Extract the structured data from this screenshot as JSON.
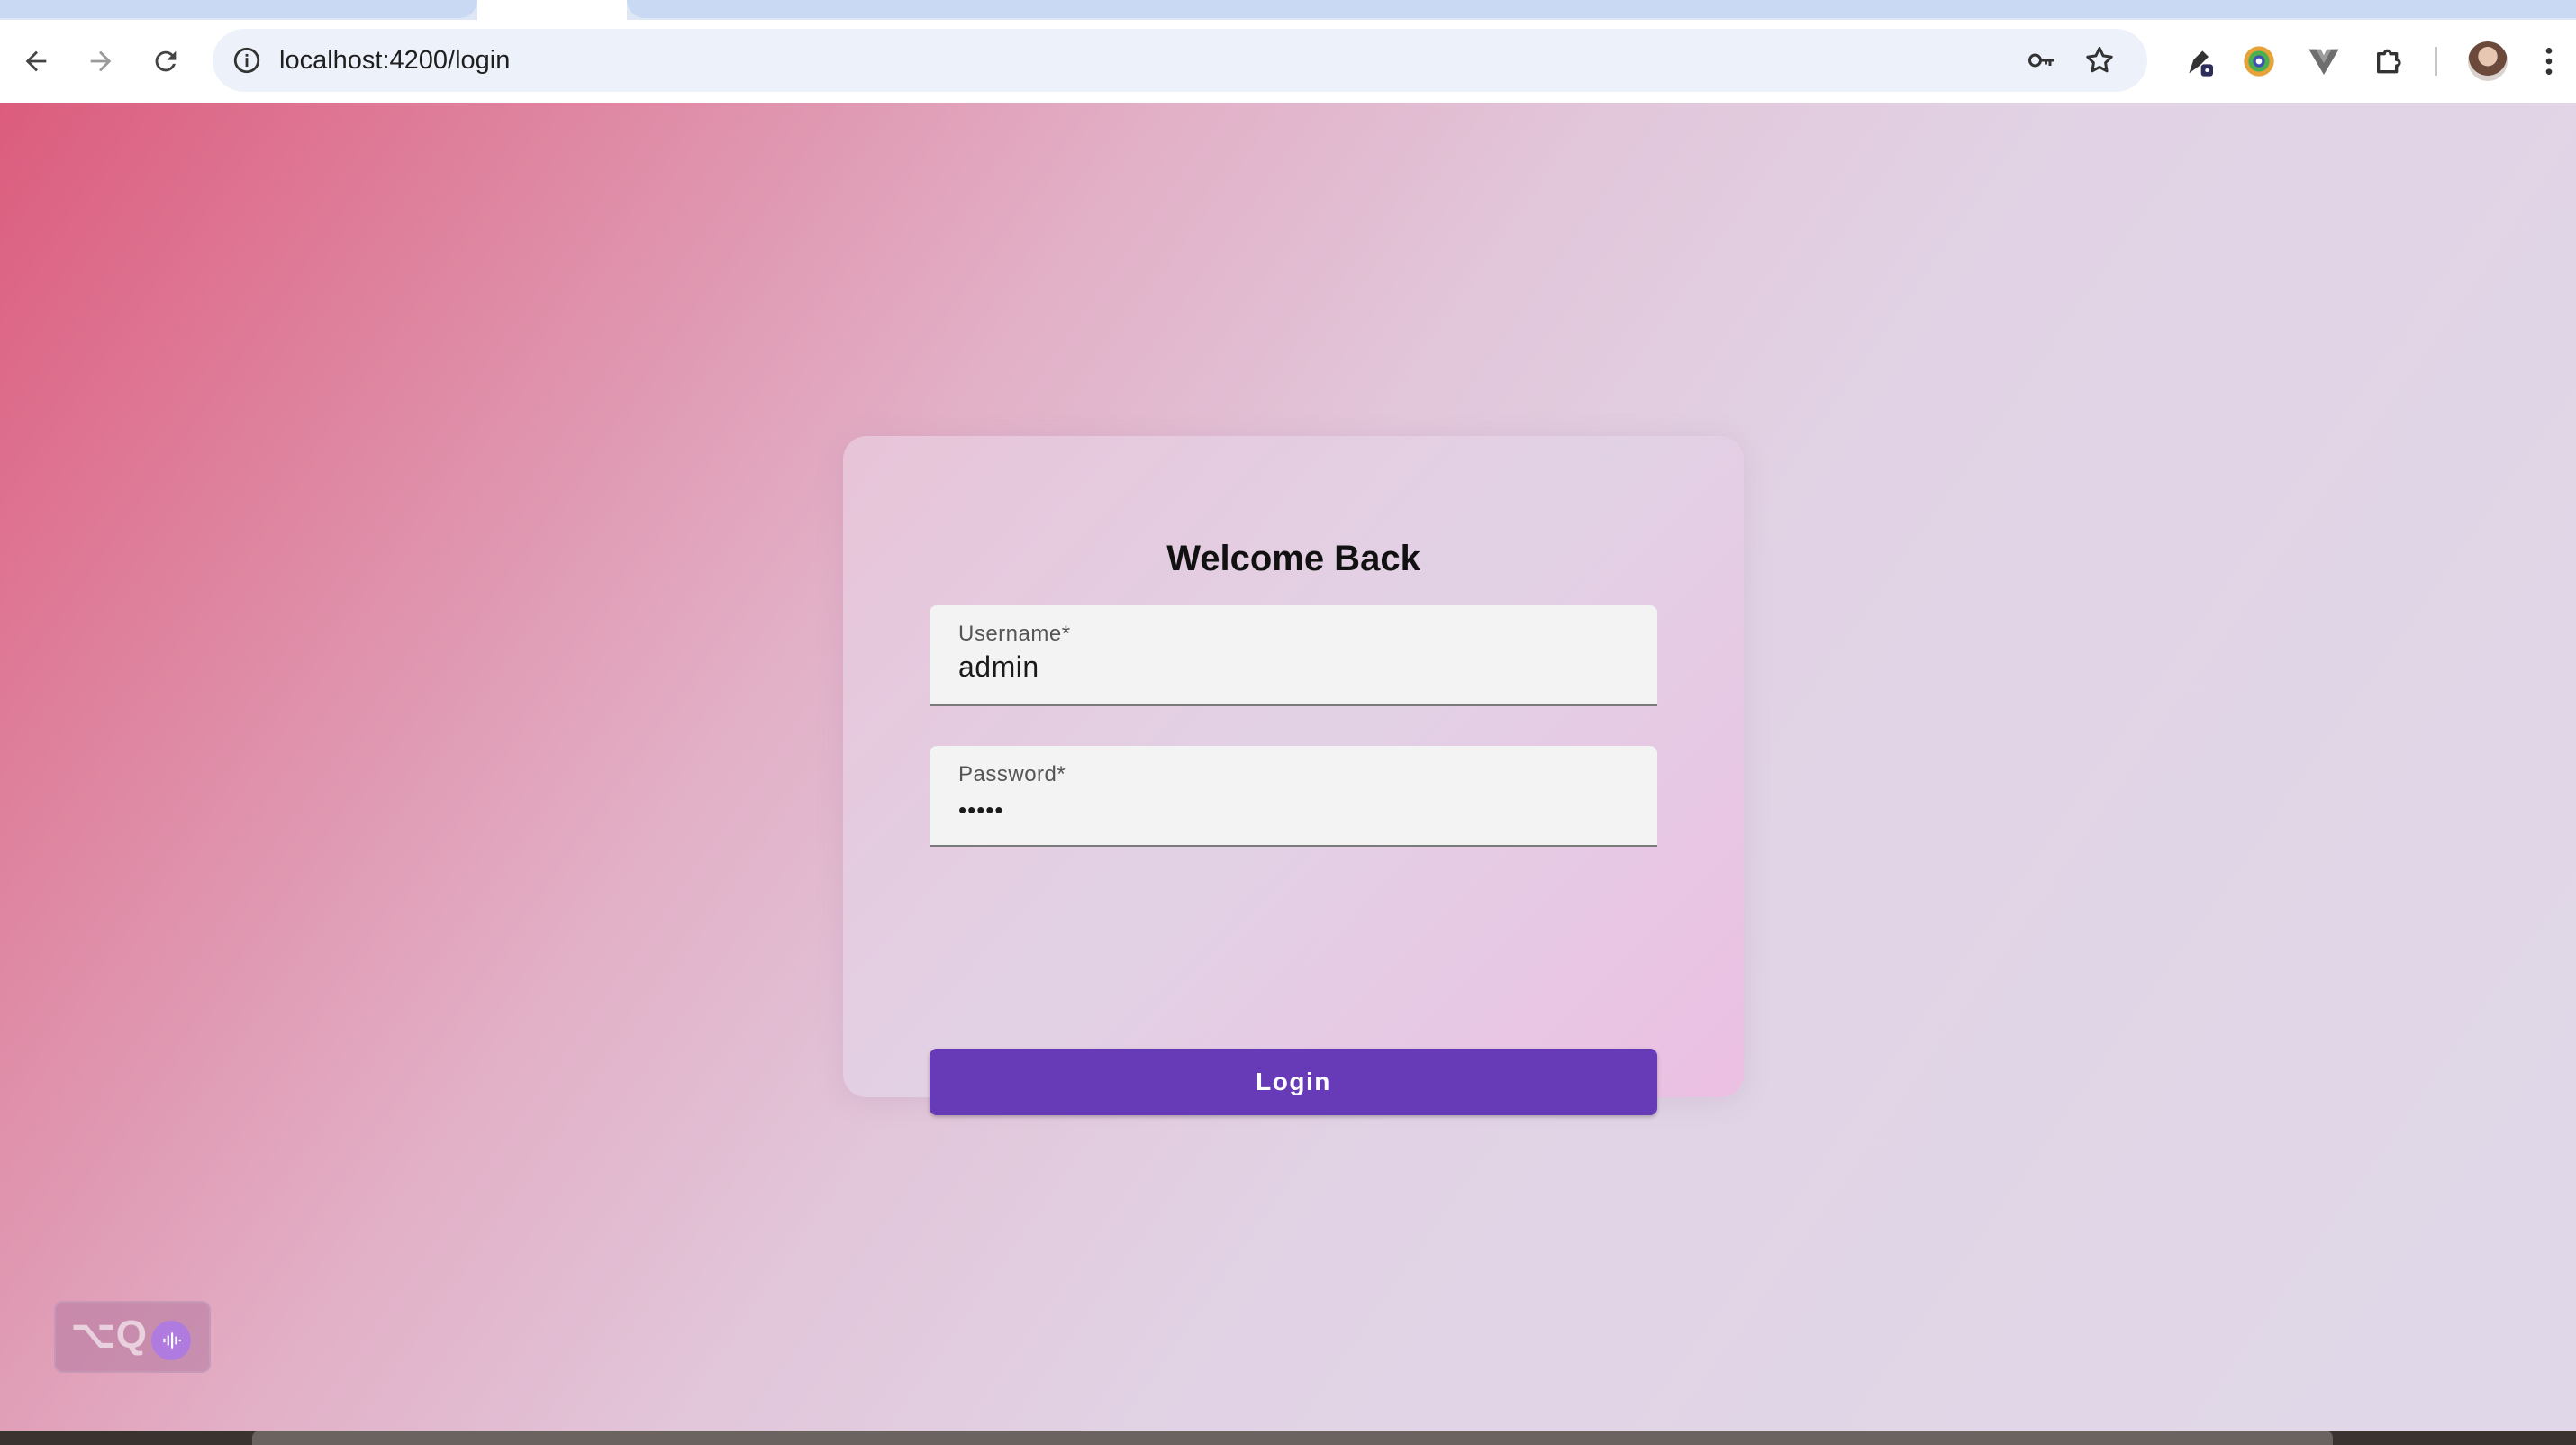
{
  "browser": {
    "url": "localhost:4200/login"
  },
  "login_card": {
    "title": "Welcome Back",
    "username": {
      "label": "Username*",
      "value": "admin"
    },
    "password": {
      "label": "Password*",
      "value": "•••••"
    },
    "login_button": "Login"
  },
  "shortcut_overlay": {
    "text": "⌥Q"
  },
  "colors": {
    "primary": "#673ab7",
    "field_bg": "#f3f3f3",
    "gradient_start": "#dc5c7d",
    "gradient_end": "#e0d8e8"
  },
  "icons": [
    "back-arrow-icon",
    "forward-arrow-icon",
    "reload-icon",
    "site-info-icon",
    "password-key-icon",
    "bookmark-star-icon",
    "extension-icon",
    "color-picker-icon",
    "vue-icon",
    "puzzle-icon",
    "avatar",
    "menu-icon",
    "audio-wave-icon"
  ]
}
